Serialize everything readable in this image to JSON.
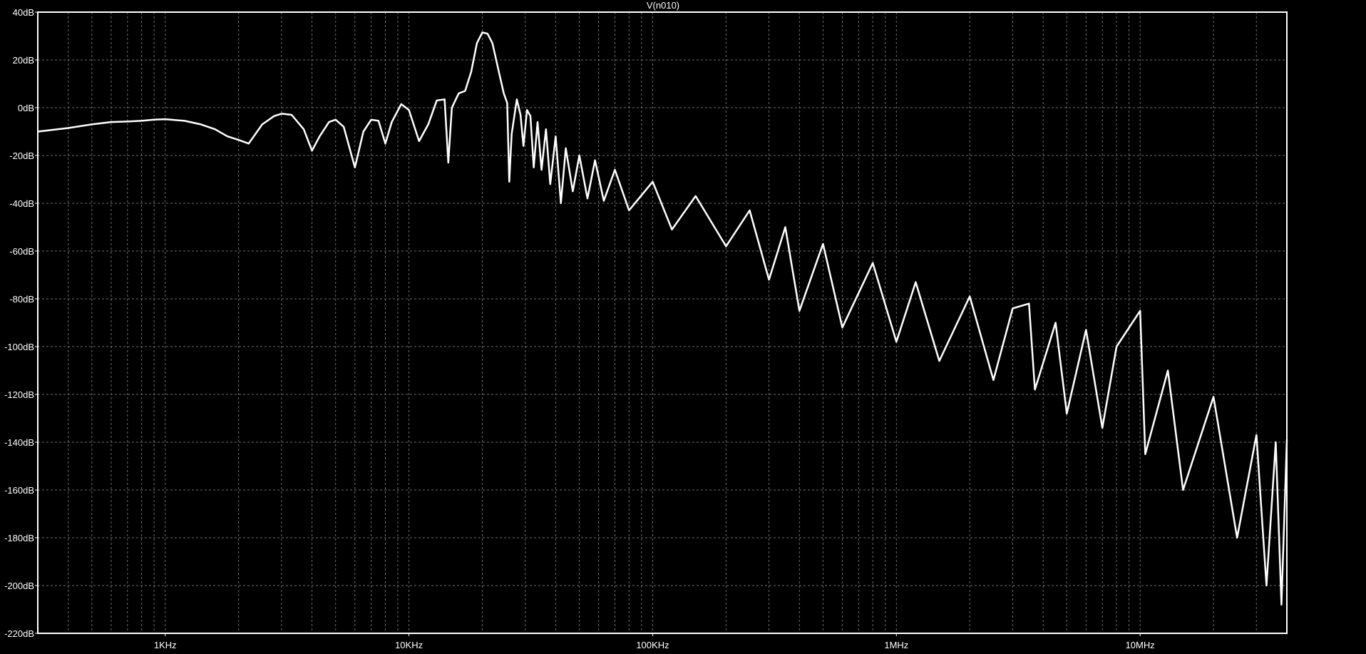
{
  "chart_data": {
    "type": "line",
    "title": "V(n010)",
    "xlabel": "",
    "ylabel": "",
    "x_scale": "log",
    "x_range_hz": [
      300,
      40000000
    ],
    "ylim_db": [
      -220,
      40
    ],
    "grid": true,
    "background_color": "#000000",
    "trace_color": "#ffffff",
    "grid_color": "#6e6e6e",
    "y_ticks": [
      {
        "value": 40,
        "label": "40dB"
      },
      {
        "value": 20,
        "label": "20dB"
      },
      {
        "value": 0,
        "label": "0dB"
      },
      {
        "value": -20,
        "label": "-20dB"
      },
      {
        "value": -40,
        "label": "-40dB"
      },
      {
        "value": -60,
        "label": "-60dB"
      },
      {
        "value": -80,
        "label": "-80dB"
      },
      {
        "value": -100,
        "label": "-100dB"
      },
      {
        "value": -120,
        "label": "-120dB"
      },
      {
        "value": -140,
        "label": "-140dB"
      },
      {
        "value": -160,
        "label": "-160dB"
      },
      {
        "value": -180,
        "label": "-180dB"
      },
      {
        "value": -200,
        "label": "-200dB"
      },
      {
        "value": -220,
        "label": "-220dB"
      }
    ],
    "x_ticks": [
      {
        "value": 1000,
        "label": "1KHz"
      },
      {
        "value": 10000,
        "label": "10KHz"
      },
      {
        "value": 100000,
        "label": "100KHz"
      },
      {
        "value": 1000000,
        "label": "1MHz"
      },
      {
        "value": 10000000,
        "label": "10MHz"
      }
    ],
    "series": [
      {
        "points": [
          [
            300,
            -10
          ],
          [
            400,
            -8.5
          ],
          [
            500,
            -7
          ],
          [
            600,
            -6
          ],
          [
            700,
            -5.8
          ],
          [
            800,
            -5.5
          ],
          [
            900,
            -5
          ],
          [
            1000,
            -4.8
          ],
          [
            1200,
            -5.5
          ],
          [
            1400,
            -7
          ],
          [
            1600,
            -9
          ],
          [
            1800,
            -12
          ],
          [
            2000,
            -13.5
          ],
          [
            2200,
            -15
          ],
          [
            2500,
            -7
          ],
          [
            2800,
            -3.5
          ],
          [
            3000,
            -2.5
          ],
          [
            3300,
            -3
          ],
          [
            3700,
            -9
          ],
          [
            4000,
            -18
          ],
          [
            4300,
            -12
          ],
          [
            4700,
            -6
          ],
          [
            5000,
            -5
          ],
          [
            5400,
            -8
          ],
          [
            6000,
            -25
          ],
          [
            6500,
            -10
          ],
          [
            7000,
            -5
          ],
          [
            7500,
            -5.5
          ],
          [
            8000,
            -15
          ],
          [
            8500,
            -6
          ],
          [
            9300,
            1.5
          ],
          [
            10000,
            -1
          ],
          [
            11000,
            -14
          ],
          [
            12000,
            -7
          ],
          [
            13000,
            3
          ],
          [
            14000,
            3.5
          ],
          [
            14500,
            -23
          ],
          [
            15000,
            0
          ],
          [
            16000,
            6
          ],
          [
            17000,
            7
          ],
          [
            18000,
            15
          ],
          [
            19000,
            27
          ],
          [
            20000,
            31.5
          ],
          [
            21000,
            31
          ],
          [
            22000,
            27
          ],
          [
            23500,
            14
          ],
          [
            24500,
            6
          ],
          [
            25300,
            2
          ],
          [
            25800,
            -31
          ],
          [
            26400,
            -11
          ],
          [
            27700,
            3.5
          ],
          [
            28700,
            -3
          ],
          [
            29500,
            -16
          ],
          [
            30500,
            -1
          ],
          [
            31500,
            -3.5
          ],
          [
            32500,
            -25
          ],
          [
            33700,
            -6
          ],
          [
            35000,
            -26
          ],
          [
            36500,
            -9
          ],
          [
            38000,
            -32
          ],
          [
            40000,
            -12
          ],
          [
            42000,
            -40
          ],
          [
            44000,
            -17
          ],
          [
            47000,
            -35
          ],
          [
            50000,
            -20
          ],
          [
            54000,
            -38
          ],
          [
            58000,
            -22
          ],
          [
            63000,
            -39
          ],
          [
            70000,
            -26
          ],
          [
            80000,
            -43
          ],
          [
            100000,
            -31
          ],
          [
            120000,
            -51
          ],
          [
            150000,
            -37
          ],
          [
            200000,
            -58
          ],
          [
            250000,
            -43
          ],
          [
            300000,
            -72
          ],
          [
            350000,
            -50
          ],
          [
            400000,
            -85
          ],
          [
            500000,
            -57
          ],
          [
            600000,
            -92
          ],
          [
            800000,
            -65
          ],
          [
            1000000,
            -98
          ],
          [
            1200000,
            -73
          ],
          [
            1500000,
            -106
          ],
          [
            2000000,
            -79
          ],
          [
            2500000,
            -114
          ],
          [
            3000000,
            -84
          ],
          [
            3500000,
            -82
          ],
          [
            3700000,
            -118
          ],
          [
            4500000,
            -90
          ],
          [
            5000000,
            -128
          ],
          [
            6000000,
            -93
          ],
          [
            7000000,
            -134
          ],
          [
            8000000,
            -100
          ],
          [
            10000000,
            -85
          ],
          [
            10500000,
            -145
          ],
          [
            13000000,
            -110
          ],
          [
            15000000,
            -160
          ],
          [
            20000000,
            -121
          ],
          [
            25000000,
            -180
          ],
          [
            30000000,
            -137
          ],
          [
            33000000,
            -200
          ],
          [
            36000000,
            -140
          ],
          [
            38000000,
            -208
          ],
          [
            40000000,
            -139
          ]
        ]
      }
    ]
  }
}
